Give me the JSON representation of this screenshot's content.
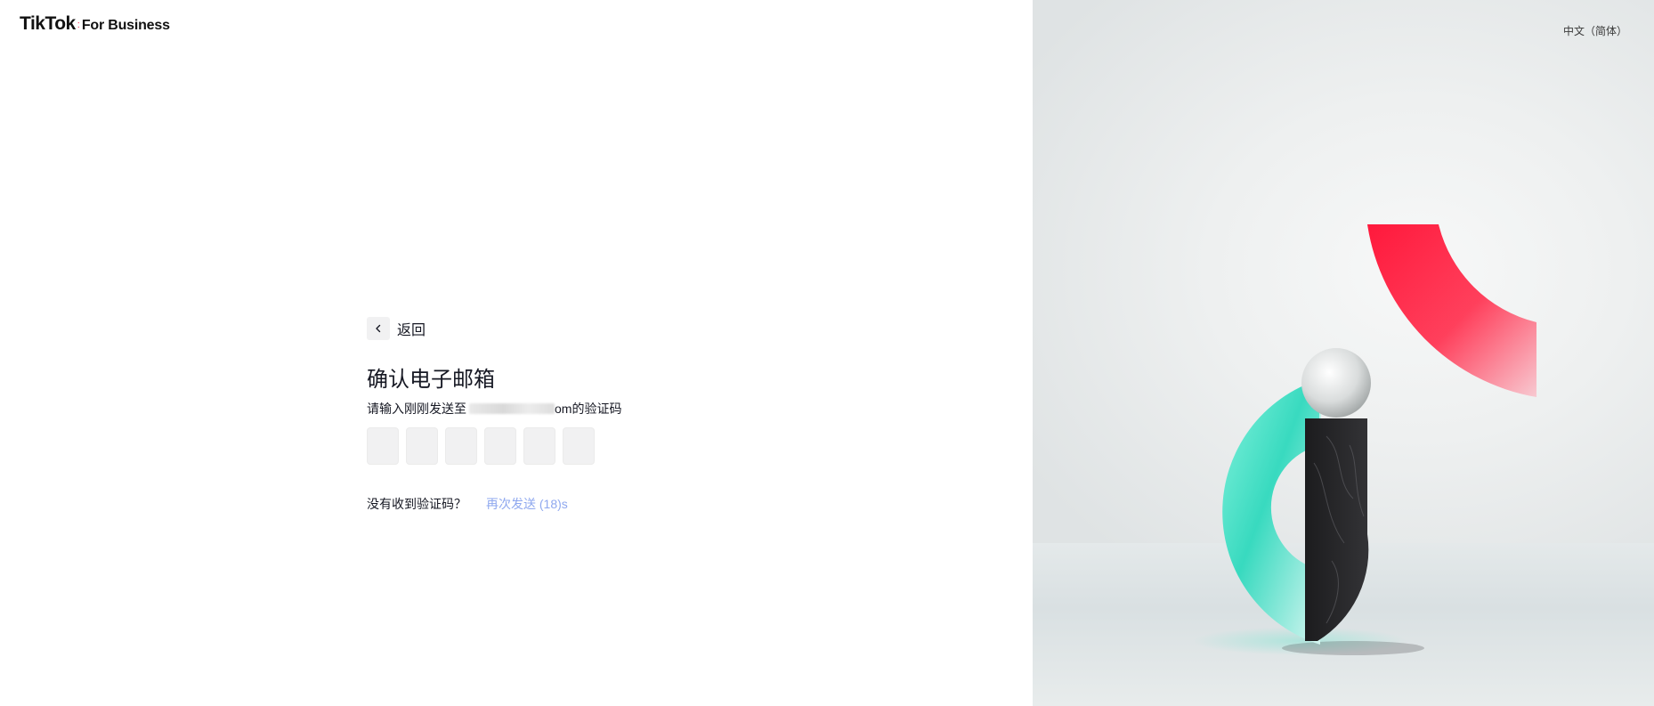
{
  "brand": {
    "name": "TikTok",
    "separator": ":",
    "suffix": "For Business"
  },
  "language_selector": "中文（简体）",
  "form": {
    "back_label": "返回",
    "title": "确认电子邮箱",
    "subtitle_prefix": "请输入刚刚发送至",
    "subtitle_email_suffix": "om",
    "subtitle_suffix": " 的验证码",
    "code_digits": [
      "",
      "",
      "",
      "",
      "",
      ""
    ],
    "resend_question": "没有收到验证码？",
    "resend_link": "再次发送 (18)s"
  },
  "colors": {
    "accent_red": "#fe2c55",
    "accent_teal": "#25f4ee",
    "link": "#8fa8ef",
    "input_bg": "#f1f1f2"
  }
}
